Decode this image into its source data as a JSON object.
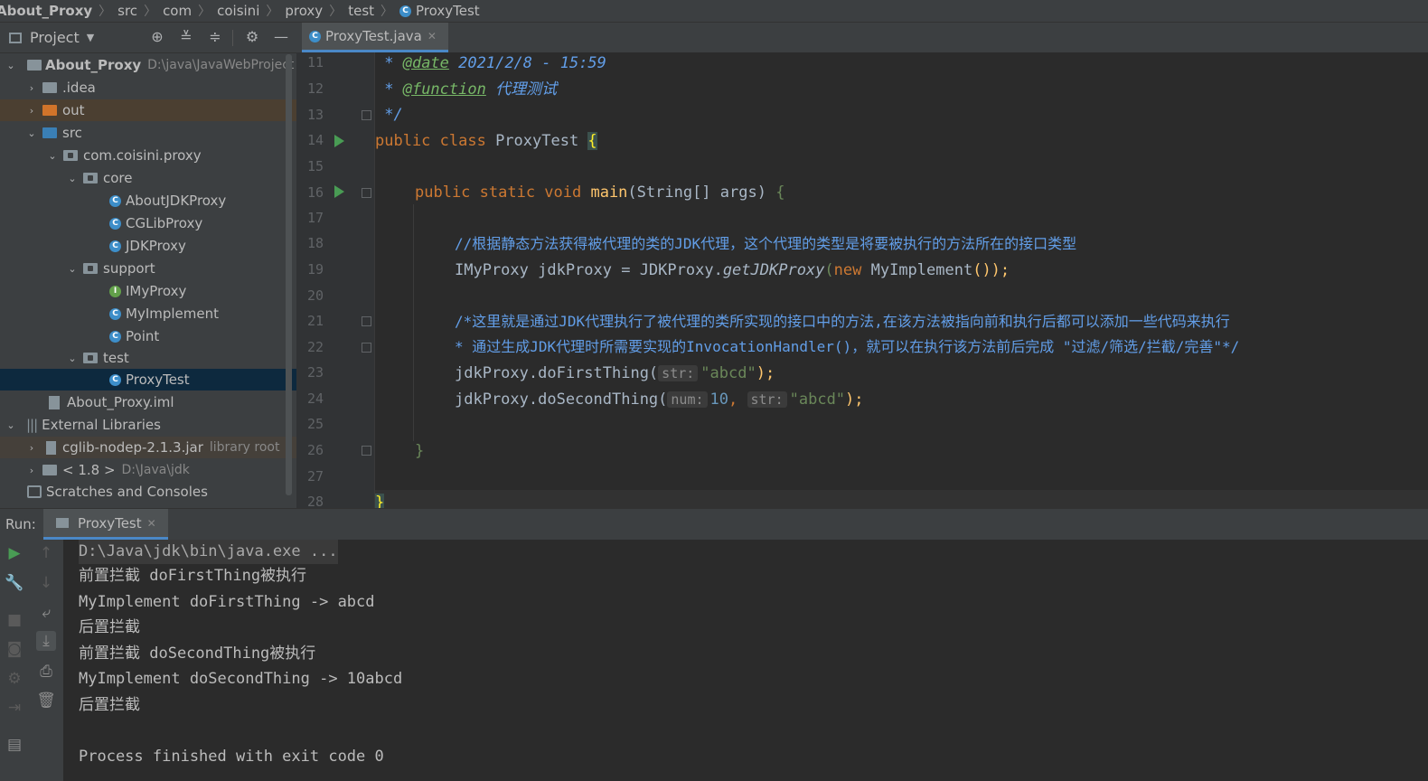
{
  "breadcrumb": [
    "About_Proxy",
    "src",
    "com",
    "coisini",
    "proxy",
    "test",
    "ProxyTest"
  ],
  "project_panel": {
    "title": "Project",
    "tree": [
      {
        "label": "About_Proxy",
        "hint": "D:\\java\\JavaWebProject",
        "icon": "module-folder-icon"
      },
      {
        "label": ".idea",
        "icon": "folder-icon"
      },
      {
        "label": "out",
        "icon": "folder-icon"
      },
      {
        "label": "src",
        "icon": "folder-icon"
      },
      {
        "label": "com.coisini.proxy",
        "icon": "package-icon"
      },
      {
        "label": "core",
        "icon": "package-icon"
      },
      {
        "label": "AboutJDKProxy",
        "icon": "class-icon"
      },
      {
        "label": "CGLibProxy",
        "icon": "class-icon"
      },
      {
        "label": "JDKProxy",
        "icon": "class-icon"
      },
      {
        "label": "support",
        "icon": "package-icon"
      },
      {
        "label": "IMyProxy",
        "icon": "interface-icon"
      },
      {
        "label": "MyImplement",
        "icon": "class-icon"
      },
      {
        "label": "Point",
        "icon": "class-icon"
      },
      {
        "label": "test",
        "icon": "package-icon"
      },
      {
        "label": "ProxyTest",
        "icon": "class-icon"
      },
      {
        "label": "About_Proxy.iml",
        "icon": "iml-file-icon"
      },
      {
        "label": "External Libraries",
        "icon": "libraries-icon"
      },
      {
        "label": "cglib-nodep-2.1.3.jar",
        "hint": "library root",
        "icon": "jar-icon"
      },
      {
        "label": "< 1.8 >",
        "hint": "D:\\Java\\jdk",
        "icon": "jdk-icon"
      },
      {
        "label": "Scratches and Consoles",
        "icon": "scratches-icon"
      }
    ]
  },
  "editor": {
    "tab_label": "ProxyTest.java",
    "line_numbers": [
      "11",
      "12",
      "13",
      "14",
      "15",
      "16",
      "17",
      "18",
      "19",
      "20",
      "21",
      "22",
      "23",
      "24",
      "25",
      "26",
      "27",
      "28"
    ],
    "lines": {
      "l11_star": " * ",
      "l11_tag": "@date",
      "l11_text": " 2021/2/8 - 15:59",
      "l12_star": " * ",
      "l12_tag": "@function",
      "l12_text": " 代理测试",
      "l13": " */",
      "l14_a": "public class ",
      "l14_b": "ProxyTest ",
      "l14_c": "{",
      "l16_a": "public static void ",
      "l16_b": "main",
      "l16_c": "(String[] args) ",
      "l16_d": "{",
      "l18": "//根据静态方法获得被代理的类的JDK代理，这个代理的类型是将要被执行的方法所在的接口类型",
      "l19_a": "IMyProxy jdkProxy = JDKProxy.",
      "l19_b": "getJDKProxy",
      "l19_c": "(",
      "l19_d": "new ",
      "l19_e": "MyImplement",
      "l19_f": "());",
      "l21": "/*这里就是通过JDK代理执行了被代理的类所实现的接口中的方法,在该方法被指向前和执行后都可以添加一些代码来执行",
      "l22": "* 通过生成JDK代理时所需要实现的InvocationHandler()，就可以在执行该方法前后完成 \"过滤/筛选/拦截/完善\"*/",
      "l23_a": "jdkProxy.doFirstThing(",
      "l23_hint": "str:",
      "l23_b": "\"abcd\"",
      "l23_c": ");",
      "l24_a": "jdkProxy.doSecondThing(",
      "l24_hint1": "num:",
      "l24_num": "10",
      "l24_comma": ", ",
      "l24_hint2": "str:",
      "l24_b": "\"abcd\"",
      "l24_c": ");",
      "l26": "}",
      "l28": "}"
    }
  },
  "run_panel": {
    "label": "Run:",
    "tab_label": "ProxyTest",
    "console": [
      "D:\\Java\\jdk\\bin\\java.exe ...",
      "前置拦截 doFirstThing被执行",
      "MyImplement doFirstThing -> abcd",
      "后置拦截",
      "前置拦截 doSecondThing被执行",
      "MyImplement doSecondThing -> 10abcd",
      "后置拦截",
      "",
      "Process finished with exit code 0"
    ]
  },
  "colors": {
    "background": "#2b2b2b",
    "panel": "#3c3f41",
    "keyword": "#cc7832",
    "string": "#6a8759",
    "number": "#6897bb",
    "method": "#ffc66d",
    "comment": "#629ee8",
    "selection": "#0d293e",
    "accent": "#4a88c7"
  }
}
